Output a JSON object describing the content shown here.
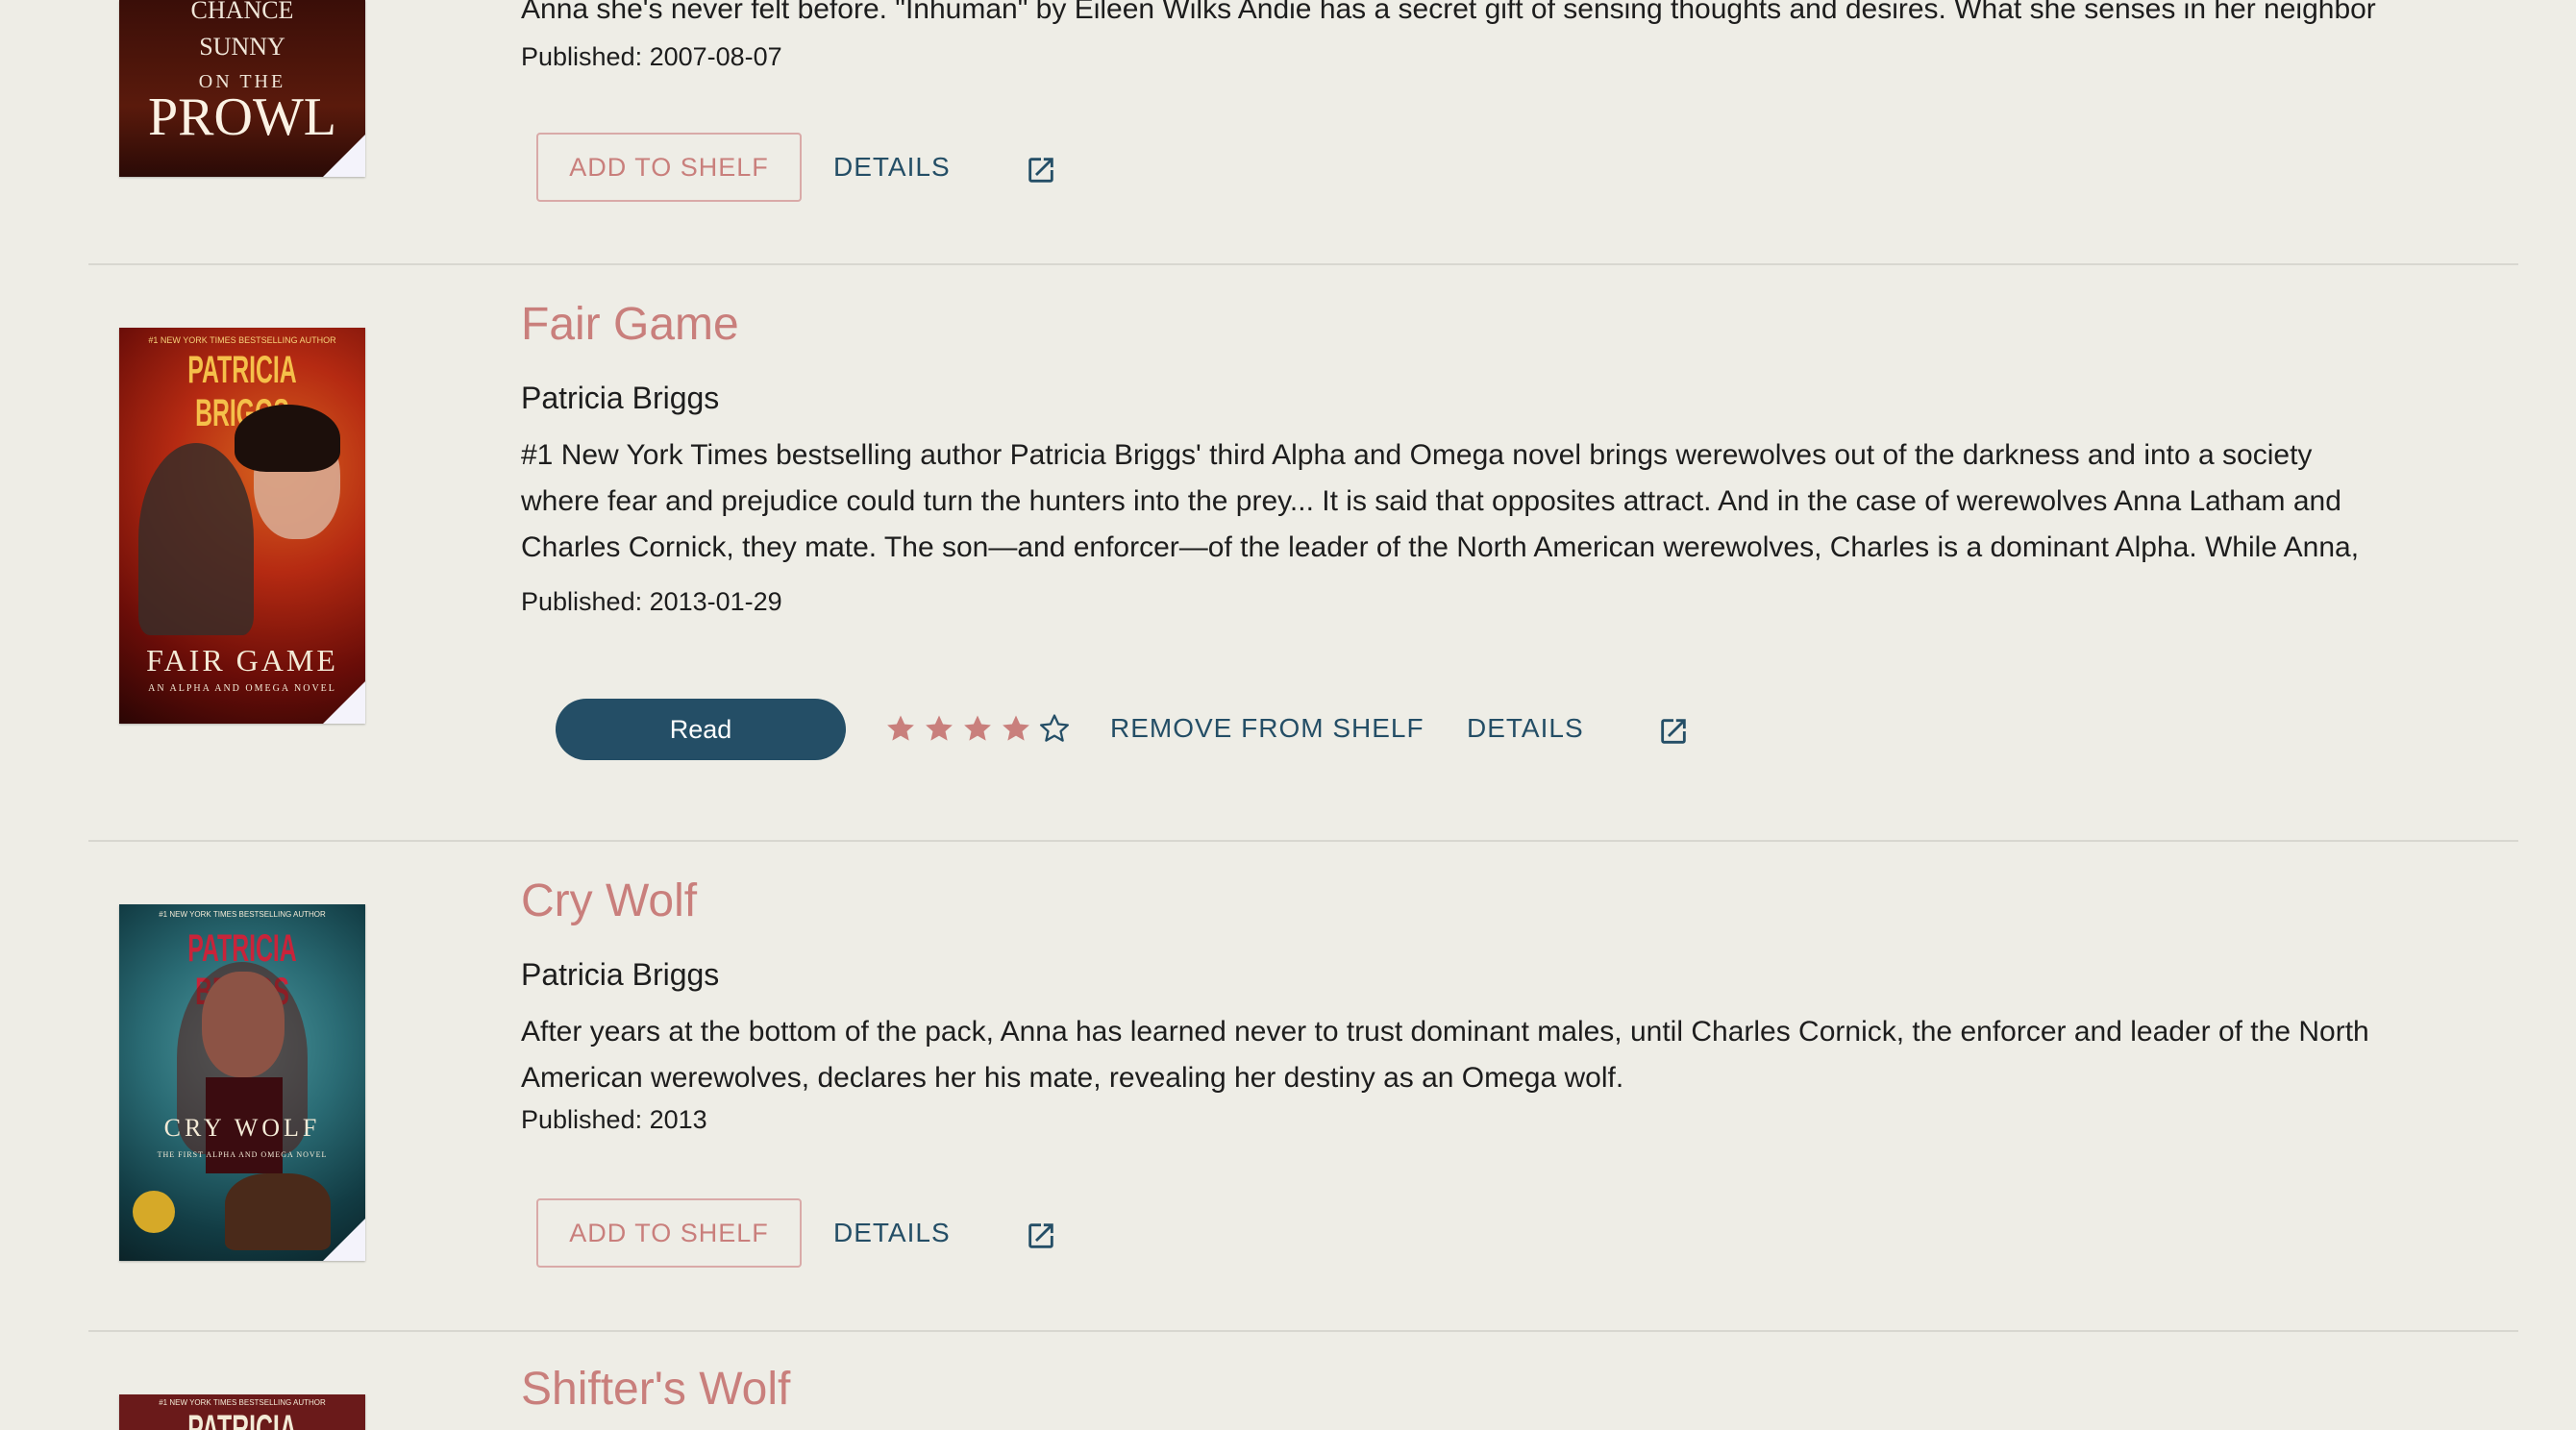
{
  "books": [
    {
      "cover": {
        "text_top": "CHANCE",
        "text_mid": "SUNNY",
        "text_on": "ON THE",
        "text_big": "PROWL"
      },
      "description": "Anna she's never felt before. \"Inhuman\" by Eileen Wilks Andie has a secret gift of sensing thoughts and desires. What she senses in her neighbor",
      "published": "Published: 2007-08-07",
      "actions": {
        "add_label": "ADD TO SHELF",
        "details_label": "DETAILS"
      }
    },
    {
      "title": "Fair Game",
      "author": "Patricia Briggs",
      "cover": {
        "author_text": "PATRICIA BRIGGS",
        "title_text": "FAIR GAME",
        "subtitle_text": "AN ALPHA AND OMEGA NOVEL",
        "top_text": "#1 NEW YORK TIMES BESTSELLING AUTHOR"
      },
      "description_lines": [
        "#1 New York Times bestselling author Patricia Briggs' third Alpha and Omega novel brings werewolves out of the darkness and into a society",
        "where fear and prejudice could turn the hunters into the prey... It is said that opposites attract. And in the case of werewolves Anna Latham and",
        "Charles Cornick, they mate. The son—and enforcer—of the leader of the North American werewolves, Charles is a dominant Alpha. While Anna,"
      ],
      "published": "Published: 2013-01-29",
      "status_label": "Read",
      "rating": 4,
      "rating_max": 5,
      "actions": {
        "remove_label": "REMOVE FROM SHELF",
        "details_label": "DETAILS"
      }
    },
    {
      "title": "Cry Wolf",
      "author": "Patricia Briggs",
      "cover": {
        "author_text": "PATRICIA BRIGGS",
        "title_text": "CRY WOLF",
        "subtitle_text": "THE FIRST ALPHA AND OMEGA NOVEL",
        "top_text": "#1 NEW YORK TIMES BESTSELLING AUTHOR"
      },
      "description_lines": [
        "After years at the bottom of the pack, Anna has learned never to trust dominant males, until Charles Cornick, the enforcer and leader of the North",
        "American werewolves, declares her his mate, revealing her destiny as an Omega wolf."
      ],
      "published": "Published: 2013",
      "actions": {
        "add_label": "ADD TO SHELF",
        "details_label": "DETAILS"
      }
    },
    {
      "title": "Shifter's Wolf",
      "cover": {
        "top_text": "#1 NEW YORK TIMES BESTSELLING AUTHOR",
        "author_text": "PATRICIA BRIGGS"
      }
    }
  ],
  "colors": {
    "background": "#eeede6",
    "accent_pink": "#c97f7c",
    "primary_blue": "#244e66",
    "star": "#c97f7c"
  },
  "icons": {
    "external": "external-link-icon",
    "star_filled": "star-filled-icon",
    "star_empty": "star-outline-icon"
  }
}
